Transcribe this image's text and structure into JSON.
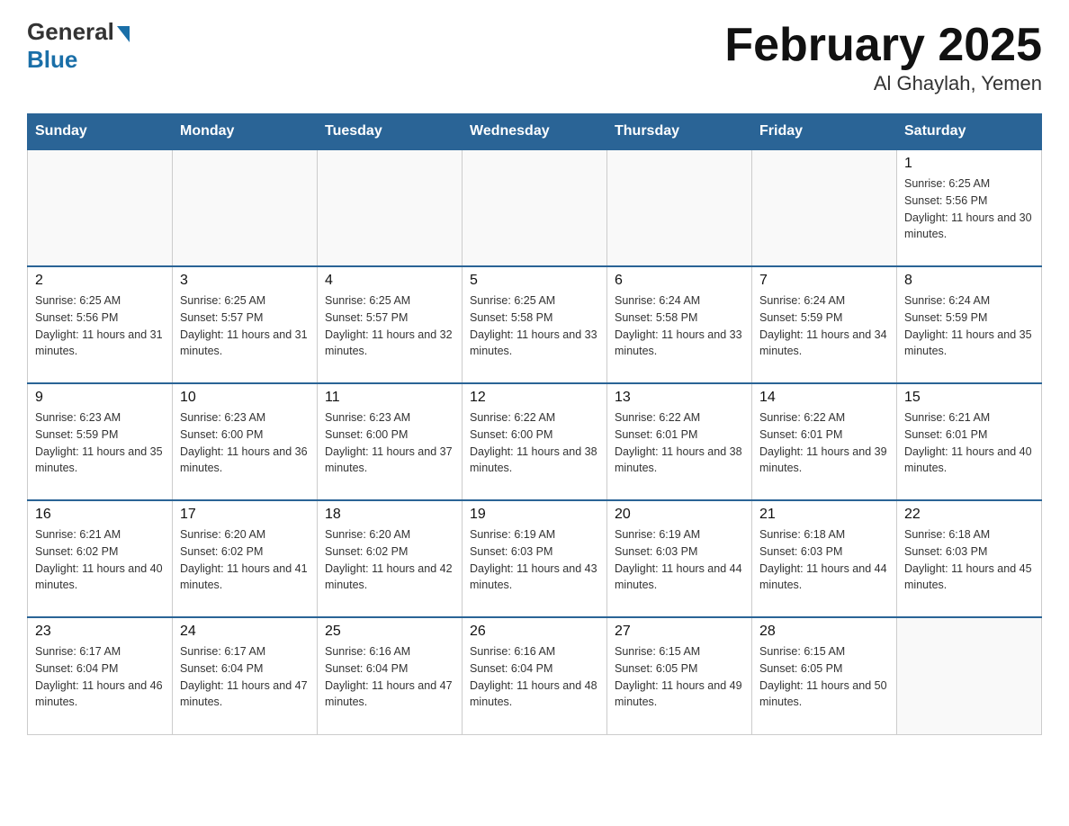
{
  "logo": {
    "general": "General",
    "blue": "Blue"
  },
  "title": "February 2025",
  "subtitle": "Al Ghaylah, Yemen",
  "days_header": [
    "Sunday",
    "Monday",
    "Tuesday",
    "Wednesday",
    "Thursday",
    "Friday",
    "Saturday"
  ],
  "weeks": [
    [
      {
        "day": "",
        "info": ""
      },
      {
        "day": "",
        "info": ""
      },
      {
        "day": "",
        "info": ""
      },
      {
        "day": "",
        "info": ""
      },
      {
        "day": "",
        "info": ""
      },
      {
        "day": "",
        "info": ""
      },
      {
        "day": "1",
        "info": "Sunrise: 6:25 AM\nSunset: 5:56 PM\nDaylight: 11 hours and 30 minutes."
      }
    ],
    [
      {
        "day": "2",
        "info": "Sunrise: 6:25 AM\nSunset: 5:56 PM\nDaylight: 11 hours and 31 minutes."
      },
      {
        "day": "3",
        "info": "Sunrise: 6:25 AM\nSunset: 5:57 PM\nDaylight: 11 hours and 31 minutes."
      },
      {
        "day": "4",
        "info": "Sunrise: 6:25 AM\nSunset: 5:57 PM\nDaylight: 11 hours and 32 minutes."
      },
      {
        "day": "5",
        "info": "Sunrise: 6:25 AM\nSunset: 5:58 PM\nDaylight: 11 hours and 33 minutes."
      },
      {
        "day": "6",
        "info": "Sunrise: 6:24 AM\nSunset: 5:58 PM\nDaylight: 11 hours and 33 minutes."
      },
      {
        "day": "7",
        "info": "Sunrise: 6:24 AM\nSunset: 5:59 PM\nDaylight: 11 hours and 34 minutes."
      },
      {
        "day": "8",
        "info": "Sunrise: 6:24 AM\nSunset: 5:59 PM\nDaylight: 11 hours and 35 minutes."
      }
    ],
    [
      {
        "day": "9",
        "info": "Sunrise: 6:23 AM\nSunset: 5:59 PM\nDaylight: 11 hours and 35 minutes."
      },
      {
        "day": "10",
        "info": "Sunrise: 6:23 AM\nSunset: 6:00 PM\nDaylight: 11 hours and 36 minutes."
      },
      {
        "day": "11",
        "info": "Sunrise: 6:23 AM\nSunset: 6:00 PM\nDaylight: 11 hours and 37 minutes."
      },
      {
        "day": "12",
        "info": "Sunrise: 6:22 AM\nSunset: 6:00 PM\nDaylight: 11 hours and 38 minutes."
      },
      {
        "day": "13",
        "info": "Sunrise: 6:22 AM\nSunset: 6:01 PM\nDaylight: 11 hours and 38 minutes."
      },
      {
        "day": "14",
        "info": "Sunrise: 6:22 AM\nSunset: 6:01 PM\nDaylight: 11 hours and 39 minutes."
      },
      {
        "day": "15",
        "info": "Sunrise: 6:21 AM\nSunset: 6:01 PM\nDaylight: 11 hours and 40 minutes."
      }
    ],
    [
      {
        "day": "16",
        "info": "Sunrise: 6:21 AM\nSunset: 6:02 PM\nDaylight: 11 hours and 40 minutes."
      },
      {
        "day": "17",
        "info": "Sunrise: 6:20 AM\nSunset: 6:02 PM\nDaylight: 11 hours and 41 minutes."
      },
      {
        "day": "18",
        "info": "Sunrise: 6:20 AM\nSunset: 6:02 PM\nDaylight: 11 hours and 42 minutes."
      },
      {
        "day": "19",
        "info": "Sunrise: 6:19 AM\nSunset: 6:03 PM\nDaylight: 11 hours and 43 minutes."
      },
      {
        "day": "20",
        "info": "Sunrise: 6:19 AM\nSunset: 6:03 PM\nDaylight: 11 hours and 44 minutes."
      },
      {
        "day": "21",
        "info": "Sunrise: 6:18 AM\nSunset: 6:03 PM\nDaylight: 11 hours and 44 minutes."
      },
      {
        "day": "22",
        "info": "Sunrise: 6:18 AM\nSunset: 6:03 PM\nDaylight: 11 hours and 45 minutes."
      }
    ],
    [
      {
        "day": "23",
        "info": "Sunrise: 6:17 AM\nSunset: 6:04 PM\nDaylight: 11 hours and 46 minutes."
      },
      {
        "day": "24",
        "info": "Sunrise: 6:17 AM\nSunset: 6:04 PM\nDaylight: 11 hours and 47 minutes."
      },
      {
        "day": "25",
        "info": "Sunrise: 6:16 AM\nSunset: 6:04 PM\nDaylight: 11 hours and 47 minutes."
      },
      {
        "day": "26",
        "info": "Sunrise: 6:16 AM\nSunset: 6:04 PM\nDaylight: 11 hours and 48 minutes."
      },
      {
        "day": "27",
        "info": "Sunrise: 6:15 AM\nSunset: 6:05 PM\nDaylight: 11 hours and 49 minutes."
      },
      {
        "day": "28",
        "info": "Sunrise: 6:15 AM\nSunset: 6:05 PM\nDaylight: 11 hours and 50 minutes."
      },
      {
        "day": "",
        "info": ""
      }
    ]
  ]
}
